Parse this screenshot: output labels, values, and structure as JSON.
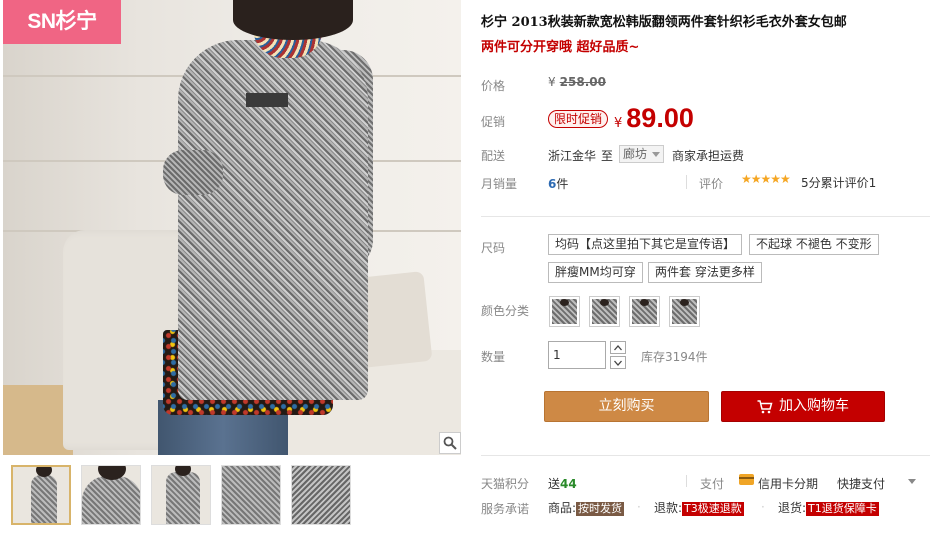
{
  "brand_logo": "SN杉宁",
  "product": {
    "title": "杉宁 2013秋装新款宽松韩版翻领两件套针织衫毛衣外套女包邮",
    "subtitle": "两件可分开穿哦 超好品质~"
  },
  "price": {
    "label": "价格",
    "currency": "¥",
    "original": "258.00"
  },
  "promo": {
    "label": "促销",
    "badge": "限时促销",
    "currency": "¥",
    "price": "89.00"
  },
  "shipping": {
    "label": "配送",
    "from": "浙江金华",
    "to_word": "至",
    "destination": "廊坊",
    "fee_note": "商家承担运费"
  },
  "sales": {
    "label": "月销量",
    "count": "6",
    "unit": "件",
    "review_label": "评价",
    "stars": "★★★★★",
    "rating_text": "5分累计评价1"
  },
  "size": {
    "label": "尺码",
    "options": [
      "均码【点这里拍下其它是宣传语】",
      "不起球 不褪色 不变形",
      "胖瘦MM均可穿",
      "两件套 穿法更多样"
    ]
  },
  "color": {
    "label": "颜色分类",
    "option_count": 4
  },
  "quantity": {
    "label": "数量",
    "value": "1",
    "stock": "库存3194件"
  },
  "actions": {
    "buy_now": "立刻购买",
    "add_cart": "加入购物车"
  },
  "tmall_points": {
    "label": "天猫积分",
    "prefix": "送",
    "points": "44"
  },
  "payment": {
    "label": "支付",
    "credit": "信用卡分期",
    "quick": "快捷支付"
  },
  "service": {
    "label": "服务承诺",
    "goods_prefix": "商品:",
    "goods_tag": "按时发货",
    "refund_prefix": "退款:",
    "refund_tag": "T3极速退款",
    "return_prefix": "退货:",
    "return_tag": "T1退货保障卡"
  },
  "colors": {
    "accent_red": "#c40000",
    "buy_orange": "#ce8945",
    "logo_pink": "#f06584",
    "link_blue": "#2d6ab2",
    "points_green": "#2a8a2a"
  }
}
